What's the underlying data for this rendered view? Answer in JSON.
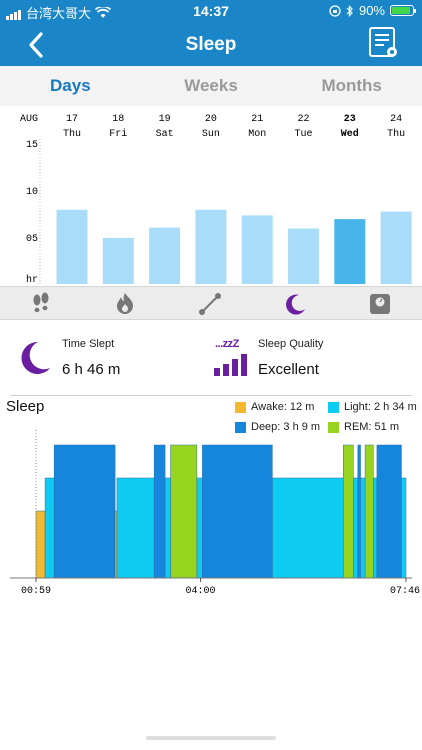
{
  "status_bar": {
    "carrier": "台湾大哥大",
    "time": "14:37",
    "battery": "90%",
    "battery_level": 0.9
  },
  "header": {
    "title": "Sleep",
    "color": "#1a86c8"
  },
  "tabs": [
    {
      "label": "Days",
      "active": true
    },
    {
      "label": "Weeks",
      "active": false
    },
    {
      "label": "Months",
      "active": false
    }
  ],
  "daily_chart": {
    "month_label": "AUG",
    "y_unit_label": "hr",
    "y_ticks": [
      "15",
      "10",
      "05"
    ],
    "ylim": [
      0,
      15
    ],
    "days": [
      {
        "date": "17",
        "weekday": "Thu",
        "hours": 7.9,
        "selected": false
      },
      {
        "date": "18",
        "weekday": "Fri",
        "hours": 4.9,
        "selected": false
      },
      {
        "date": "19",
        "weekday": "Sat",
        "hours": 6.0,
        "selected": false
      },
      {
        "date": "20",
        "weekday": "Sun",
        "hours": 7.9,
        "selected": false
      },
      {
        "date": "21",
        "weekday": "Mon",
        "hours": 7.3,
        "selected": false
      },
      {
        "date": "22",
        "weekday": "Tue",
        "hours": 5.9,
        "selected": false
      },
      {
        "date": "23",
        "weekday": "Wed",
        "hours": 6.9,
        "selected": true
      },
      {
        "date": "24",
        "weekday": "Thu",
        "hours": 7.7,
        "selected": false
      }
    ],
    "bar_color": "#a8dcf8",
    "selected_color": "#47b4ea"
  },
  "activity_icons": [
    {
      "name": "steps-icon",
      "active": false
    },
    {
      "name": "calories-icon",
      "active": false
    },
    {
      "name": "distance-icon",
      "active": false
    },
    {
      "name": "sleep-icon",
      "active": true
    },
    {
      "name": "weight-icon",
      "active": false
    }
  ],
  "summary": {
    "time_slept_label": "Time Slept",
    "time_slept_value": "6 h 46 m",
    "quality_label": "Sleep Quality",
    "quality_value": "Excellent",
    "icon_zzz": "...zzZ"
  },
  "sleep_graph": {
    "title": "Sleep",
    "legend": [
      {
        "key": "awake",
        "label": "Awake: 12 m",
        "color": "#f2b92f"
      },
      {
        "key": "light",
        "label": "Light: 2 h 34 m",
        "color": "#0ecbf2"
      },
      {
        "key": "deep",
        "label": "Deep: 3 h 9 m",
        "color": "#1686dc"
      },
      {
        "key": "rem",
        "label": "REM: 51 m",
        "color": "#96d420"
      }
    ],
    "x_ticks": [
      "00:59",
      "04:00",
      "07:46"
    ],
    "start_min": 59,
    "end_min": 466,
    "segments": [
      {
        "stage": "awake",
        "start": 59,
        "end": 69
      },
      {
        "stage": "light",
        "start": 69,
        "end": 79
      },
      {
        "stage": "deep",
        "start": 79,
        "end": 146
      },
      {
        "stage": "awake",
        "start": 146,
        "end": 148
      },
      {
        "stage": "light",
        "start": 148,
        "end": 189
      },
      {
        "stage": "deep",
        "start": 189,
        "end": 201
      },
      {
        "stage": "light",
        "start": 201,
        "end": 207
      },
      {
        "stage": "rem",
        "start": 207,
        "end": 236
      },
      {
        "stage": "light",
        "start": 236,
        "end": 242
      },
      {
        "stage": "deep",
        "start": 242,
        "end": 319
      },
      {
        "stage": "light",
        "start": 319,
        "end": 397
      },
      {
        "stage": "rem",
        "start": 397,
        "end": 408
      },
      {
        "stage": "light",
        "start": 408,
        "end": 413
      },
      {
        "stage": "deep",
        "start": 413,
        "end": 416
      },
      {
        "stage": "light",
        "start": 416,
        "end": 421
      },
      {
        "stage": "rem",
        "start": 421,
        "end": 430
      },
      {
        "stage": "light",
        "start": 430,
        "end": 434
      },
      {
        "stage": "deep",
        "start": 434,
        "end": 461
      },
      {
        "stage": "light",
        "start": 461,
        "end": 466
      }
    ]
  }
}
